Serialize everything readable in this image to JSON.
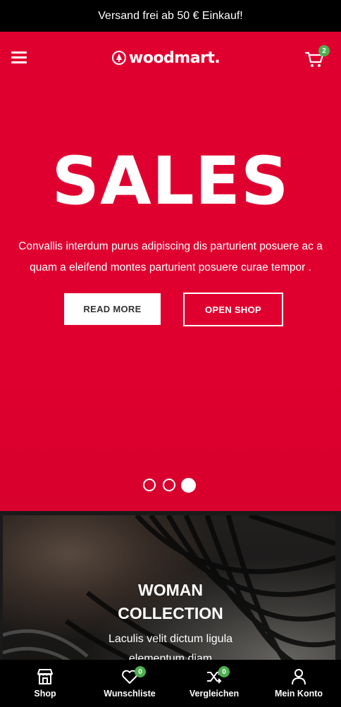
{
  "topbar": {
    "text": "Versand frei ab 50 € Einkauf!"
  },
  "header": {
    "logo_text": "woodmart.",
    "cart_count": "2"
  },
  "hero": {
    "headline": "SALES",
    "subtext": "Convallis interdum purus adipiscing dis parturient posuere ac a quam a eleifend montes parturient posuere curae tempor .",
    "read_more_label": "READ MORE",
    "open_shop_label": "OPEN SHOP",
    "slides_total": 3,
    "active_slide": 3
  },
  "promo": {
    "title_line1": "WOMAN",
    "title_line2": "COLLECTION",
    "sub_line1": "Laculis velit dictum ligula",
    "sub_line2": "elementum diam"
  },
  "bottom_nav": {
    "shop_label": "Shop",
    "wishlist_label": "Wunschliste",
    "wishlist_count": "0",
    "compare_label": "Vergleichen",
    "compare_count": "0",
    "account_label": "Mein Konto"
  },
  "colors": {
    "brand": "#e00030",
    "badge": "#4caf50"
  }
}
